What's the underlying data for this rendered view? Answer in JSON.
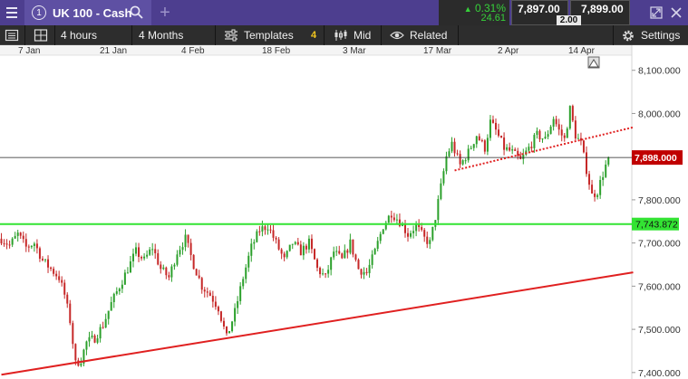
{
  "titlebar": {
    "tab_number": "1",
    "instrument": "UK 100 - Cash",
    "add_tab": "+",
    "change_pct": "0.31%",
    "change_points": "24.61",
    "sell_price": "7,897.00",
    "spread": "2.00",
    "buy_price": "7,899.00"
  },
  "toolbar": {
    "interval": "4 hours",
    "range": "4 Months",
    "templates_label": "Templates",
    "templates_count": "4",
    "price_type": "Mid",
    "related_label": "Related",
    "settings_label": "Settings"
  },
  "colors": {
    "header_bg": "#4d3e8f",
    "tab_bg": "#5e50a3",
    "toolbar_bg": "#2d2d2d",
    "up_green": "#36d13a",
    "candle_up": "#2ca02c",
    "candle_down": "#c62828",
    "support_line": "#33e333",
    "trend_line": "#e02020",
    "last_price_label": "#c00000"
  },
  "chart_data": {
    "type": "candlestick",
    "x_tick_labels": [
      "7 Jan",
      "21 Jan",
      "4 Feb",
      "18 Feb",
      "3 Mar",
      "17 Mar",
      "2 Apr",
      "14 Apr"
    ],
    "y_tick_labels": [
      "8,100.000",
      "8,000.000",
      "7,900.000",
      "7,800.000",
      "7,700.000",
      "7,600.000",
      "7,500.000",
      "7,400.000"
    ],
    "y_ticks": [
      8100,
      8000,
      7900,
      7800,
      7700,
      7600,
      7500,
      7400
    ],
    "ylim": [
      7385,
      8135
    ],
    "grid": false,
    "last_price": 7898,
    "last_price_label": "7,898.000",
    "horizontal_level": 7743.872,
    "horizontal_level_label": "7,743.872",
    "price_path": [
      [
        0,
        7710
      ],
      [
        3,
        7695
      ],
      [
        6,
        7720
      ],
      [
        9,
        7690
      ],
      [
        12,
        7700
      ],
      [
        15,
        7660
      ],
      [
        18,
        7640
      ],
      [
        21,
        7620
      ],
      [
        23,
        7580
      ],
      [
        25,
        7520
      ],
      [
        27,
        7420
      ],
      [
        29,
        7430
      ],
      [
        31,
        7470
      ],
      [
        34,
        7480
      ],
      [
        37,
        7510
      ],
      [
        40,
        7560
      ],
      [
        43,
        7600
      ],
      [
        46,
        7640
      ],
      [
        49,
        7680
      ],
      [
        52,
        7660
      ],
      [
        55,
        7690
      ],
      [
        58,
        7640
      ],
      [
        61,
        7620
      ],
      [
        64,
        7680
      ],
      [
        67,
        7710
      ],
      [
        70,
        7650
      ],
      [
        73,
        7600
      ],
      [
        76,
        7580
      ],
      [
        79,
        7550
      ],
      [
        82,
        7480
      ],
      [
        85,
        7540
      ],
      [
        88,
        7620
      ],
      [
        91,
        7690
      ],
      [
        94,
        7730
      ],
      [
        97,
        7740
      ],
      [
        100,
        7700
      ],
      [
        103,
        7660
      ],
      [
        106,
        7700
      ],
      [
        109,
        7680
      ],
      [
        112,
        7700
      ],
      [
        115,
        7640
      ],
      [
        118,
        7620
      ],
      [
        121,
        7680
      ],
      [
        124,
        7660
      ],
      [
        127,
        7700
      ],
      [
        130,
        7640
      ],
      [
        133,
        7630
      ],
      [
        136,
        7680
      ],
      [
        139,
        7740
      ],
      [
        142,
        7770
      ],
      [
        145,
        7750
      ],
      [
        148,
        7720
      ],
      [
        151,
        7740
      ],
      [
        154,
        7710
      ],
      [
        156,
        7700
      ],
      [
        158,
        7760
      ],
      [
        160,
        7830
      ],
      [
        162,
        7900
      ],
      [
        164,
        7930
      ],
      [
        167,
        7880
      ],
      [
        170,
        7910
      ],
      [
        173,
        7950
      ],
      [
        176,
        7920
      ],
      [
        178,
        7980
      ],
      [
        180,
        7960
      ],
      [
        183,
        7920
      ],
      [
        186,
        7910
      ],
      [
        189,
        7890
      ],
      [
        192,
        7920
      ],
      [
        195,
        7950
      ],
      [
        198,
        7940
      ],
      [
        201,
        7990
      ],
      [
        203,
        7960
      ],
      [
        205,
        7940
      ],
      [
        207,
        8010
      ],
      [
        209,
        7950
      ],
      [
        211,
        7930
      ],
      [
        213,
        7870
      ],
      [
        215,
        7810
      ],
      [
        217,
        7820
      ],
      [
        219,
        7860
      ],
      [
        221,
        7898
      ]
    ],
    "support_line": [
      [
        0,
        7743.872
      ],
      [
        230,
        7743.872
      ]
    ],
    "trend_lines": [
      {
        "style": "solid",
        "points": [
          [
            0,
            7395
          ],
          [
            230,
            7632
          ]
        ]
      },
      {
        "style": "dotted",
        "points": [
          [
            165,
            7868
          ],
          [
            230,
            7968
          ]
        ]
      }
    ]
  }
}
